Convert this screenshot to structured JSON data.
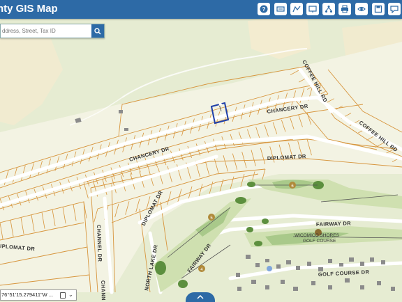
{
  "app": {
    "title": "nty GIS Map"
  },
  "toolbar": {
    "tools": [
      {
        "name": "help-icon"
      },
      {
        "name": "map-tools-icon"
      },
      {
        "name": "measure-icon"
      },
      {
        "name": "identify-icon"
      },
      {
        "name": "network-icon"
      },
      {
        "name": "print-icon"
      },
      {
        "name": "layers-icon"
      },
      {
        "name": "save-icon"
      },
      {
        "name": "comment-icon"
      }
    ]
  },
  "search": {
    "placeholder": "ddress, Street, Tax ID"
  },
  "coordinates": {
    "text": "76°51'15.279411\"W ..."
  },
  "colors": {
    "header": "#2d6aa6",
    "parcel": "#d7953d",
    "ground": "#e6ecd2",
    "golf": "#b9d49a",
    "selection": "#1f3fa8"
  },
  "map": {
    "streets": {
      "chancery_1": "CHANCERY DR",
      "chancery_2": "CHANCERY DR",
      "coffee_hill_1": "COFFEE HILL RD",
      "coffee_hill_2": "COFFEE HILL RD",
      "diplomat_1": "DIPLOMAT DR",
      "diplomat_2": "DIPLOMAT DR",
      "diplomat_3": "IPLOMAT DR",
      "fairway_1": "FAIRWAY DR",
      "fairway_2": "FAIRWAY DR",
      "channel": "CHANNEL DR",
      "channel_2": "CHANNE",
      "north_lake": "NORTH LAKE DR",
      "golf_course": "GOLF COURSE DR"
    },
    "golf_label_1": "WICOMICO SHORES",
    "golf_label_2": "GOLF COURSE",
    "holes": [
      "6",
      "5",
      "4"
    ]
  }
}
